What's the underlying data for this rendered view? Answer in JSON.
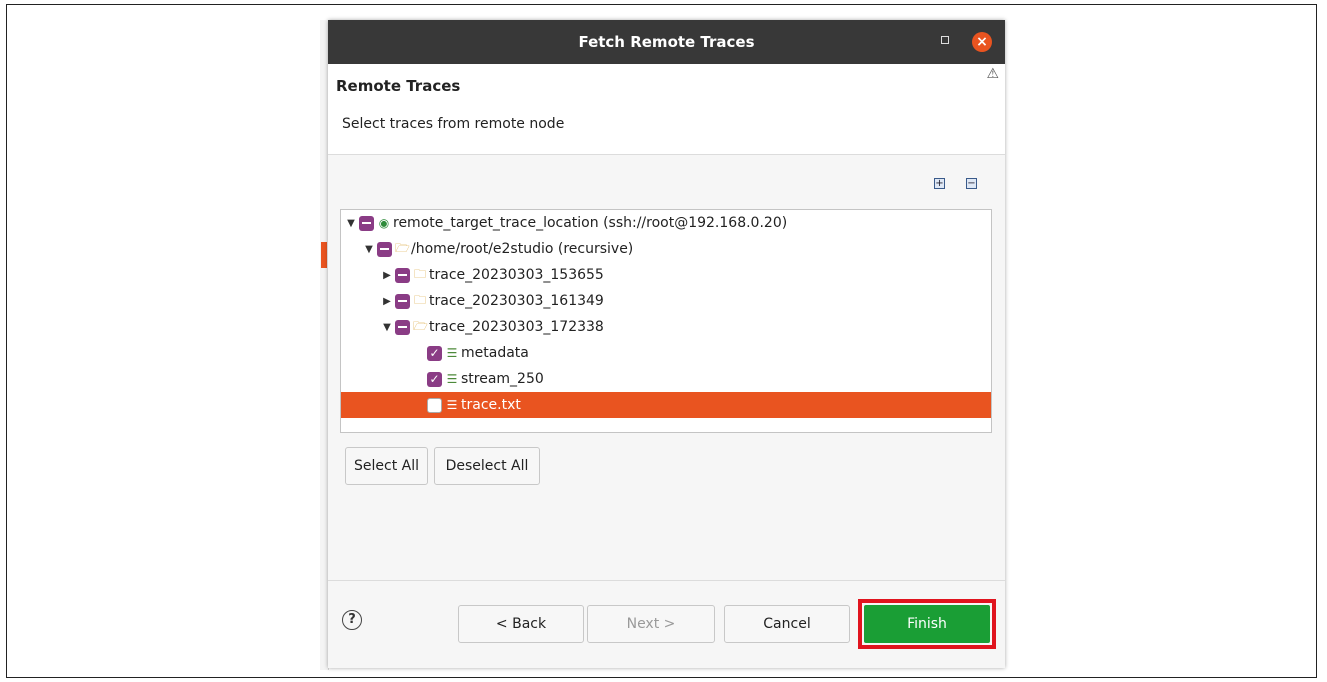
{
  "dialog": {
    "title": "Fetch Remote Traces",
    "close_glyph": "×"
  },
  "header": {
    "title": "Remote Traces",
    "description": "Select traces from remote node",
    "warn_icon": "warning-icon"
  },
  "toolbar": {
    "expand_all_icon": "expand-all-icon",
    "collapse_all_icon": "collapse-all-icon"
  },
  "tree": {
    "rows": [
      {
        "label": "remote_target_trace_location (ssh://root@192.168.0.20)",
        "state": "partial",
        "icon": "node-icon",
        "expanded": true,
        "level": 0
      },
      {
        "label": "/home/root/e2studio (recursive)",
        "state": "partial",
        "icon": "folder-icon",
        "expanded": true,
        "level": 1
      },
      {
        "label": "trace_20230303_153655",
        "state": "partial",
        "icon": "folder-icon",
        "expanded": false,
        "level": 2
      },
      {
        "label": "trace_20230303_161349",
        "state": "partial",
        "icon": "folder-icon",
        "expanded": false,
        "level": 2
      },
      {
        "label": "trace_20230303_172338",
        "state": "partial",
        "icon": "folder-icon",
        "expanded": true,
        "level": 2
      },
      {
        "label": "metadata",
        "state": "checked",
        "icon": "file-icon",
        "level": 3
      },
      {
        "label": "stream_250",
        "state": "checked",
        "icon": "file-icon",
        "level": 3
      },
      {
        "label": "trace.txt",
        "state": "unchecked",
        "icon": "file-icon",
        "level": 3,
        "selected": true
      }
    ]
  },
  "buttons": {
    "select_all": "Select All",
    "deselect_all": "Deselect All",
    "back": "< Back",
    "next": "Next >",
    "cancel": "Cancel",
    "finish": "Finish",
    "help": "?"
  },
  "colors": {
    "accent": "#e95420",
    "checkbox": "#8a3c85",
    "finish": "#1a9e35",
    "highlight_outline": "#e0141e"
  }
}
